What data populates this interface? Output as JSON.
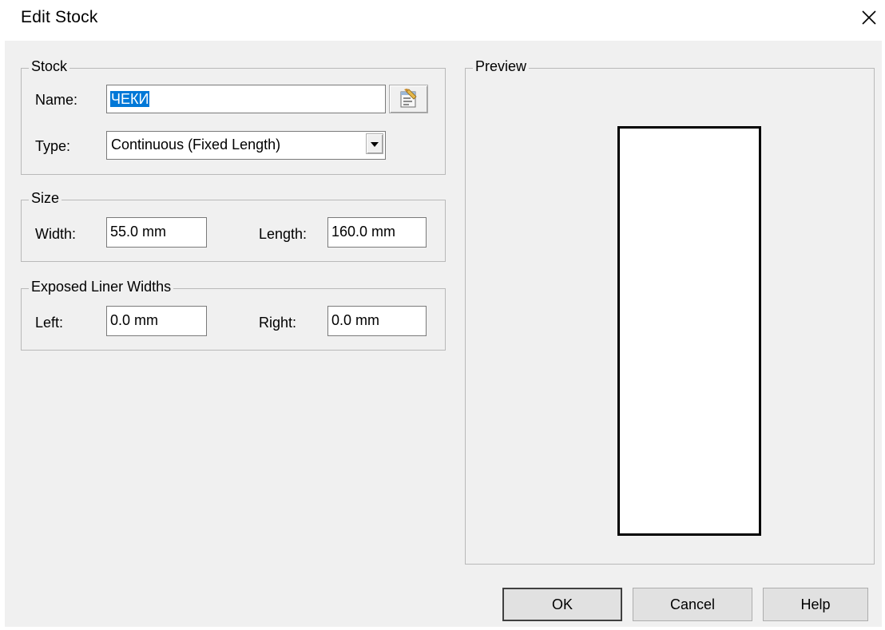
{
  "dialog": {
    "title": "Edit Stock"
  },
  "stock_group": {
    "legend": "Stock",
    "name_label": "Name:",
    "name_value": "ЧЕКИ",
    "type_label": "Type:",
    "type_value": "Continuous (Fixed Length)"
  },
  "size_group": {
    "legend": "Size",
    "width_label": "Width:",
    "width_value": "55.0 mm",
    "length_label": "Length:",
    "length_value": "160.0 mm"
  },
  "liner_group": {
    "legend": "Exposed Liner Widths",
    "left_label": "Left:",
    "left_value": "0.0 mm",
    "right_label": "Right:",
    "right_value": "0.0 mm"
  },
  "preview_group": {
    "legend": "Preview"
  },
  "buttons": {
    "ok": "OK",
    "cancel": "Cancel",
    "help": "Help"
  }
}
